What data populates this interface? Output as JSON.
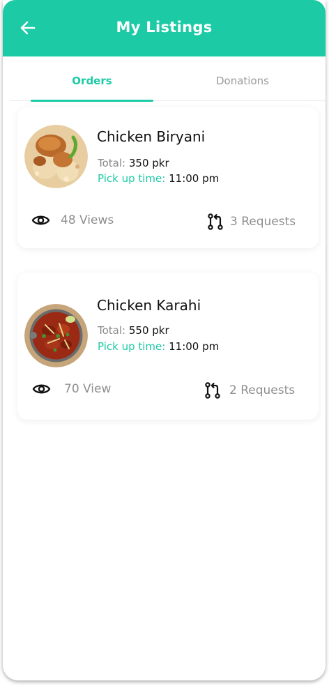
{
  "header": {
    "title": "My Listings",
    "back_icon": "arrow-left-icon",
    "background_color": "#1ccaa6"
  },
  "tabs": [
    {
      "label": "Orders",
      "active": true
    },
    {
      "label": "Donations",
      "active": false
    }
  ],
  "listings": [
    {
      "name": "Chicken Biryani",
      "total_label": "Total:",
      "total_value": "350 pkr",
      "pickup_label": "Pick up time:",
      "pickup_value": "11:00 pm",
      "views_text": "48 Views",
      "requests_text": "3 Requests"
    },
    {
      "name": "Chicken Karahi",
      "total_label": "Total:",
      "total_value": "550 pkr",
      "pickup_label": "Pick up time:",
      "pickup_value": "11:00 pm",
      "views_text": "70 View",
      "requests_text": "2 Requests"
    }
  ],
  "icons": {
    "views": "eye-icon",
    "requests": "pull-request-icon"
  },
  "colors": {
    "accent": "#1ccaa6",
    "muted_text": "#8f8f8f"
  }
}
